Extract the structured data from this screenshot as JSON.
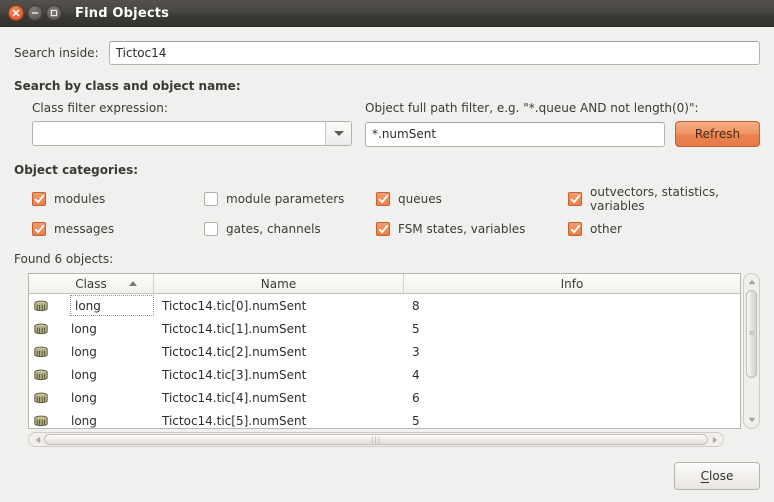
{
  "window": {
    "title": "Find Objects",
    "close_icon": "window-close-icon",
    "minimize_icon": "window-minimize-icon",
    "maximize_icon": "window-maximize-icon"
  },
  "search": {
    "label": "Search inside:",
    "value": "Tictoc14",
    "placeholder": ""
  },
  "section": {
    "search_by": "Search by class and object name:",
    "categories": "Object categories:"
  },
  "class_filter": {
    "label": "Class filter expression:",
    "value": "",
    "placeholder": "",
    "dropdown_icon": "chevron-down-icon"
  },
  "path_filter": {
    "label": "Object full path filter, e.g. \"*.queue AND not length(0)\":",
    "value": "*.numSent",
    "placeholder": ""
  },
  "refresh": {
    "label": "Refresh"
  },
  "categories": [
    {
      "label": "modules",
      "checked": true
    },
    {
      "label": "module parameters",
      "checked": false
    },
    {
      "label": "queues",
      "checked": true
    },
    {
      "label": "outvectors, statistics, variables",
      "checked": true
    },
    {
      "label": "messages",
      "checked": true
    },
    {
      "label": "gates, channels",
      "checked": false
    },
    {
      "label": "FSM states, variables",
      "checked": true
    },
    {
      "label": "other",
      "checked": true
    }
  ],
  "results": {
    "found_label": "Found 6 objects:",
    "columns": [
      "Class",
      "Name",
      "Info"
    ],
    "sort_column": "Class",
    "sort_direction": "ascending",
    "rows": [
      {
        "icon": "variable-icon",
        "class": "long",
        "name": "Tictoc14.tic[0].numSent",
        "info": "8"
      },
      {
        "icon": "variable-icon",
        "class": "long",
        "name": "Tictoc14.tic[1].numSent",
        "info": "5"
      },
      {
        "icon": "variable-icon",
        "class": "long",
        "name": "Tictoc14.tic[2].numSent",
        "info": "3"
      },
      {
        "icon": "variable-icon",
        "class": "long",
        "name": "Tictoc14.tic[3].numSent",
        "info": "4"
      },
      {
        "icon": "variable-icon",
        "class": "long",
        "name": "Tictoc14.tic[4].numSent",
        "info": "6"
      },
      {
        "icon": "variable-icon",
        "class": "long",
        "name": "Tictoc14.tic[5].numSent",
        "info": "5"
      }
    ]
  },
  "footer": {
    "close_label": "Close",
    "close_mnemonic": "C"
  },
  "colors": {
    "accent": "#ea8550",
    "titlebar": "#474540",
    "background": "#f0f0ee"
  }
}
